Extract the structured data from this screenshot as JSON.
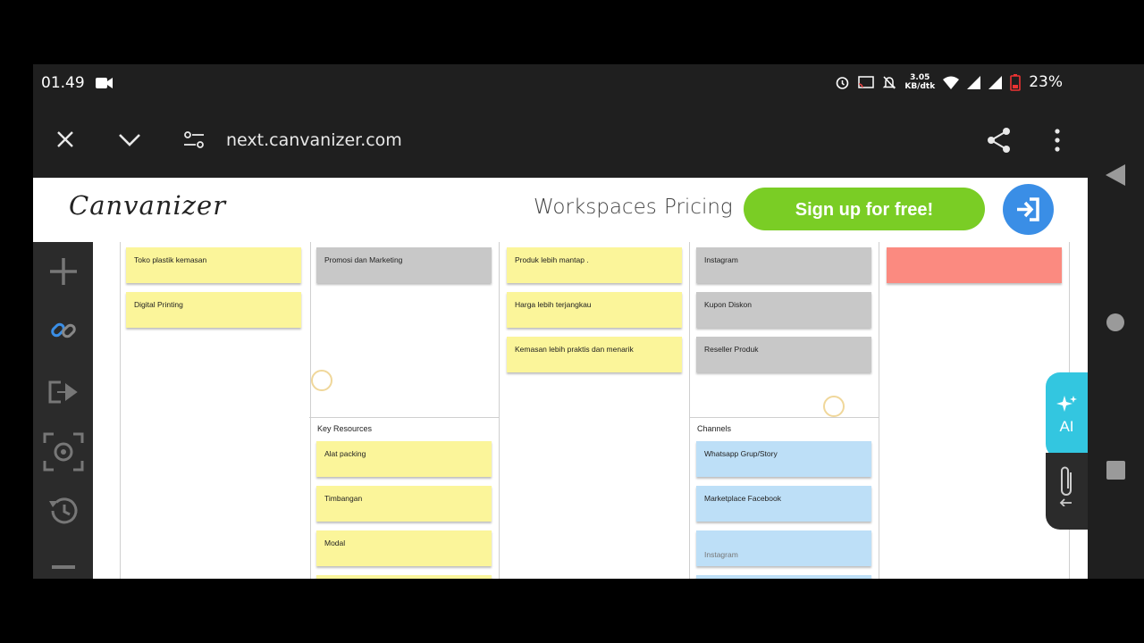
{
  "status_bar": {
    "time": "01.49",
    "speed_value": "3.05",
    "speed_unit": "KB/dtk",
    "battery": "23%"
  },
  "browser": {
    "url": "next.canvanizer.com"
  },
  "header": {
    "logo": "Canvanizer",
    "nav": [
      "Workspaces",
      "Pricing"
    ],
    "signup_label": "Sign up for free!"
  },
  "canvas": {
    "col1_notes": [
      "Toko plastik kemasan",
      "Digital Printing"
    ],
    "col2_notes": [
      "Promosi dan Marketing"
    ],
    "col3_notes": [
      "Produk lebih mantap .",
      "Harga lebih terjangkau",
      "Kemasan lebih praktis dan menarik"
    ],
    "col4_notes": [
      "Instagram",
      "Kupon Diskon",
      "Reseller Produk"
    ],
    "key_resources_label": "Key Resources",
    "key_resources_notes": [
      "Alat packing",
      "Timbangan",
      "Modal"
    ],
    "channels_label": "Channels",
    "channels_notes": [
      "Whatsapp Grup/Story",
      "Marketplace Facebook",
      "Instagram"
    ]
  },
  "ai_tab_label": "AI",
  "colors": {
    "signup": "#7acd25",
    "login": "#3a8ee6",
    "ai_tab": "#33c6e0",
    "note_yellow": "#fbf59a",
    "note_grey": "#c8c8c8",
    "note_blue": "#bddff7",
    "note_red": "#fb8a80"
  }
}
